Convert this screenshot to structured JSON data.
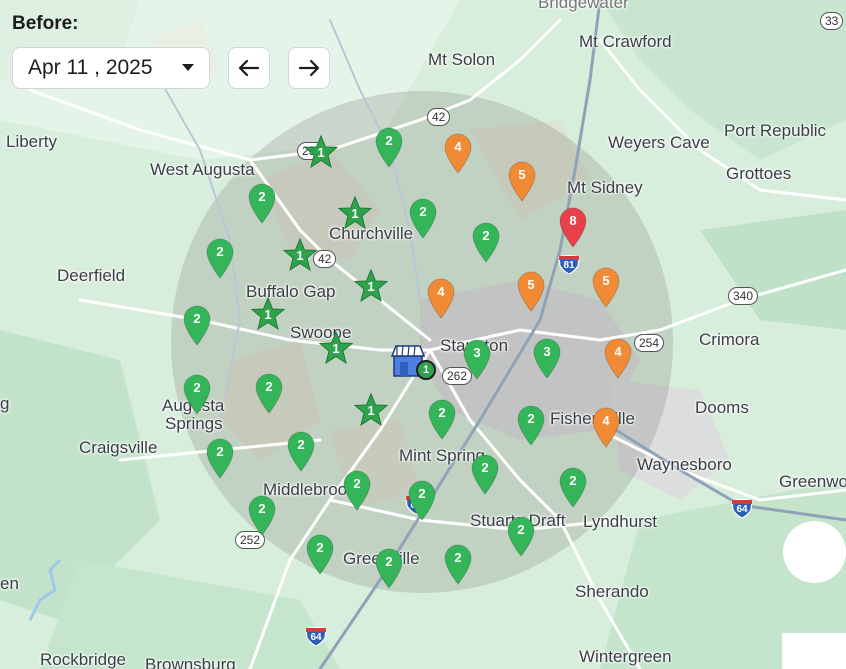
{
  "header": {
    "label": "Before:",
    "date_value": "Apr 11 , 2025",
    "dropdown_icon": "caret-down-icon",
    "prev_icon": "arrow-left-icon",
    "next_icon": "arrow-right-icon"
  },
  "places": {
    "bridgewater": "Bridgewater",
    "mt_crawford": "Mt Crawford",
    "mt_solon": "Mt Solon",
    "weyers_cave": "Weyers Cave",
    "port_republic": "Port Republic",
    "grottoes": "Grottoes",
    "liberty": "Liberty",
    "west_augusta": "West Augusta",
    "mt_sidney": "Mt Sidney",
    "churchville": "Churchville",
    "deerfield": "Deerfield",
    "buffalo_gap": "Buffalo Gap",
    "crimora": "Crimora",
    "swoope": "Swoope",
    "staunton": "Staunton",
    "augusta_springs_1": "Augusta",
    "augusta_springs_2": "Springs",
    "dooms": "Dooms",
    "fishersville": "Fishersville",
    "craigsville": "Craigsville",
    "mint_spring": "Mint Spring",
    "waynesboro": "Waynesboro",
    "middlebrook": "Middlebrook",
    "greenwood": "Greenwo",
    "stuarts_draft": "Stuarts Draft",
    "lyndhurst": "Lyndhurst",
    "greenville": "Greenville",
    "sherando": "Sherando",
    "rockbridge": "Rockbridge",
    "brownsburg": "Brownsburg",
    "wintergreen": "Wintergreen",
    "left_g": "g",
    "left_en": "en"
  },
  "shields": {
    "s33": "33",
    "s42a": "42",
    "s42b": "42",
    "s250": "250",
    "s262": "262",
    "s254": "254",
    "s340": "340",
    "s252": "252",
    "i81": "81",
    "i64a": "64",
    "i64b": "64",
    "i64c": "64"
  },
  "markers": [
    {
      "kind": "pin",
      "rank": "2",
      "color": "#34b55a"
    },
    {
      "kind": "pin",
      "rank": "4",
      "color": "#f08a34"
    },
    {
      "kind": "pin",
      "rank": "5",
      "color": "#f08a34"
    },
    {
      "kind": "pin",
      "rank": "2",
      "color": "#34b55a"
    },
    {
      "kind": "pin",
      "rank": "2",
      "color": "#34b55a"
    },
    {
      "kind": "pin",
      "rank": "8",
      "color": "#e8414a"
    },
    {
      "kind": "pin",
      "rank": "2",
      "color": "#34b55a"
    },
    {
      "kind": "pin",
      "rank": "2",
      "color": "#34b55a"
    },
    {
      "kind": "pin",
      "rank": "4",
      "color": "#f08a34"
    },
    {
      "kind": "pin",
      "rank": "5",
      "color": "#f08a34"
    },
    {
      "kind": "pin",
      "rank": "5",
      "color": "#f08a34"
    },
    {
      "kind": "pin",
      "rank": "2",
      "color": "#34b55a"
    },
    {
      "kind": "pin",
      "rank": "3",
      "color": "#34b55a"
    },
    {
      "kind": "pin",
      "rank": "3",
      "color": "#34b55a"
    },
    {
      "kind": "pin",
      "rank": "4",
      "color": "#f08a34"
    },
    {
      "kind": "pin",
      "rank": "2",
      "color": "#34b55a"
    },
    {
      "kind": "pin",
      "rank": "2",
      "color": "#34b55a"
    },
    {
      "kind": "pin",
      "rank": "2",
      "color": "#34b55a"
    },
    {
      "kind": "pin",
      "rank": "2",
      "color": "#34b55a"
    },
    {
      "kind": "pin",
      "rank": "4",
      "color": "#f08a34"
    },
    {
      "kind": "pin",
      "rank": "2",
      "color": "#34b55a"
    },
    {
      "kind": "pin",
      "rank": "2",
      "color": "#34b55a"
    },
    {
      "kind": "pin",
      "rank": "2",
      "color": "#34b55a"
    },
    {
      "kind": "pin",
      "rank": "2",
      "color": "#34b55a"
    },
    {
      "kind": "pin",
      "rank": "2",
      "color": "#34b55a"
    },
    {
      "kind": "pin",
      "rank": "2",
      "color": "#34b55a"
    },
    {
      "kind": "pin",
      "rank": "2",
      "color": "#34b55a"
    },
    {
      "kind": "pin",
      "rank": "2",
      "color": "#34b55a"
    },
    {
      "kind": "pin",
      "rank": "2",
      "color": "#34b55a"
    },
    {
      "kind": "pin",
      "rank": "2",
      "color": "#34b55a"
    },
    {
      "kind": "pin",
      "rank": "2",
      "color": "#34b55a"
    },
    {
      "kind": "star",
      "rank": "1",
      "color": "#2fa24c"
    },
    {
      "kind": "star",
      "rank": "1",
      "color": "#2fa24c"
    },
    {
      "kind": "star",
      "rank": "1",
      "color": "#2fa24c"
    },
    {
      "kind": "star",
      "rank": "1",
      "color": "#2fa24c"
    },
    {
      "kind": "star",
      "rank": "1",
      "color": "#2fa24c"
    },
    {
      "kind": "star",
      "rank": "1",
      "color": "#2fa24c"
    },
    {
      "kind": "star",
      "rank": "1",
      "color": "#2fa24c"
    }
  ],
  "business": {
    "icon": "store-icon",
    "rank": "1",
    "color": "#2fa24c"
  }
}
